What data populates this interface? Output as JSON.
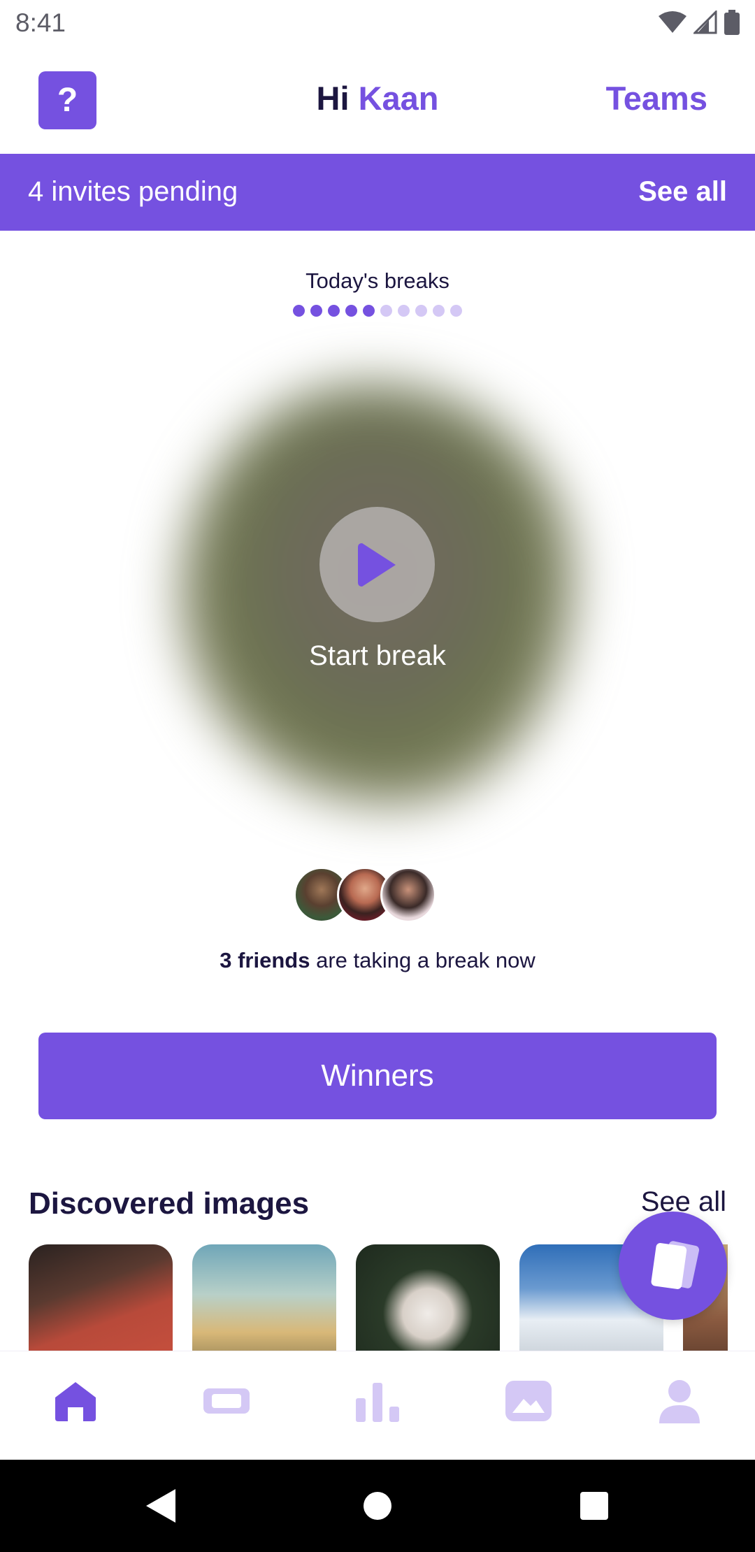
{
  "status_bar": {
    "time": "8:41"
  },
  "header": {
    "help_label": "?",
    "greeting_prefix": "Hi",
    "user_name": "Kaan",
    "teams_label": "Teams"
  },
  "invites": {
    "text": "4 invites pending",
    "link": "See all"
  },
  "breaks": {
    "title": "Today's breaks",
    "completed": 5,
    "total": 10
  },
  "start": {
    "label": "Start break"
  },
  "friends": {
    "count_text": "3 friends",
    "rest_text": "are taking a break now"
  },
  "winners": {
    "label": "Winners"
  },
  "discovered": {
    "title": "Discovered images",
    "link": "See all",
    "images": [
      "sprinter-image",
      "balloons-image",
      "dog-image",
      "mountain-image",
      "city-image"
    ]
  },
  "nav": {
    "items": [
      "home-icon",
      "ticket-icon",
      "stats-icon",
      "gallery-icon",
      "profile-icon"
    ],
    "active": "home-icon"
  },
  "colors": {
    "accent": "#7551e0",
    "text": "#1c1640",
    "muted": "#d4c8f5"
  }
}
